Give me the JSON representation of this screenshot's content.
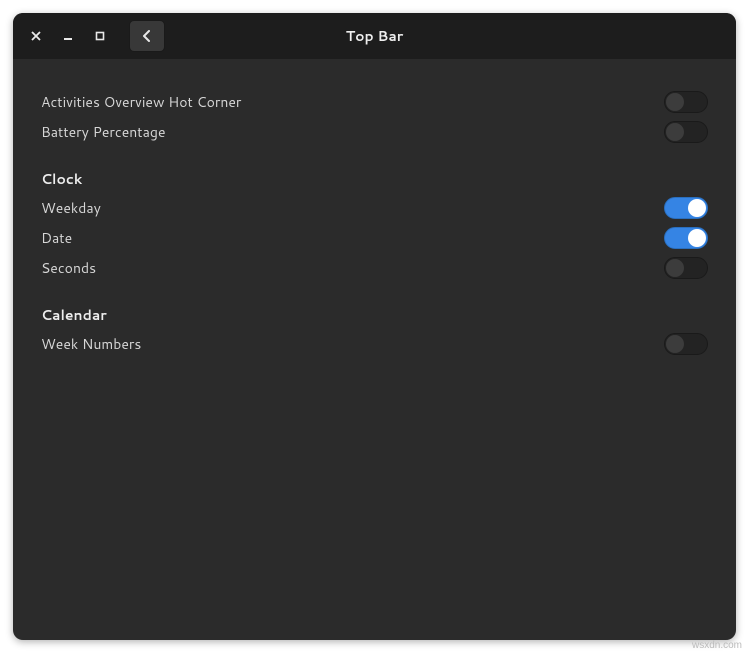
{
  "window": {
    "title": "Top Bar"
  },
  "top_rows": [
    {
      "label": "Activities Overview Hot Corner",
      "state": "off"
    },
    {
      "label": "Battery Percentage",
      "state": "off"
    }
  ],
  "sections": [
    {
      "header": "Clock",
      "rows": [
        {
          "label": "Weekday",
          "state": "on"
        },
        {
          "label": "Date",
          "state": "on"
        },
        {
          "label": "Seconds",
          "state": "off"
        }
      ]
    },
    {
      "header": "Calendar",
      "rows": [
        {
          "label": "Week Numbers",
          "state": "off"
        }
      ]
    }
  ],
  "watermark": "wsxdn.com"
}
